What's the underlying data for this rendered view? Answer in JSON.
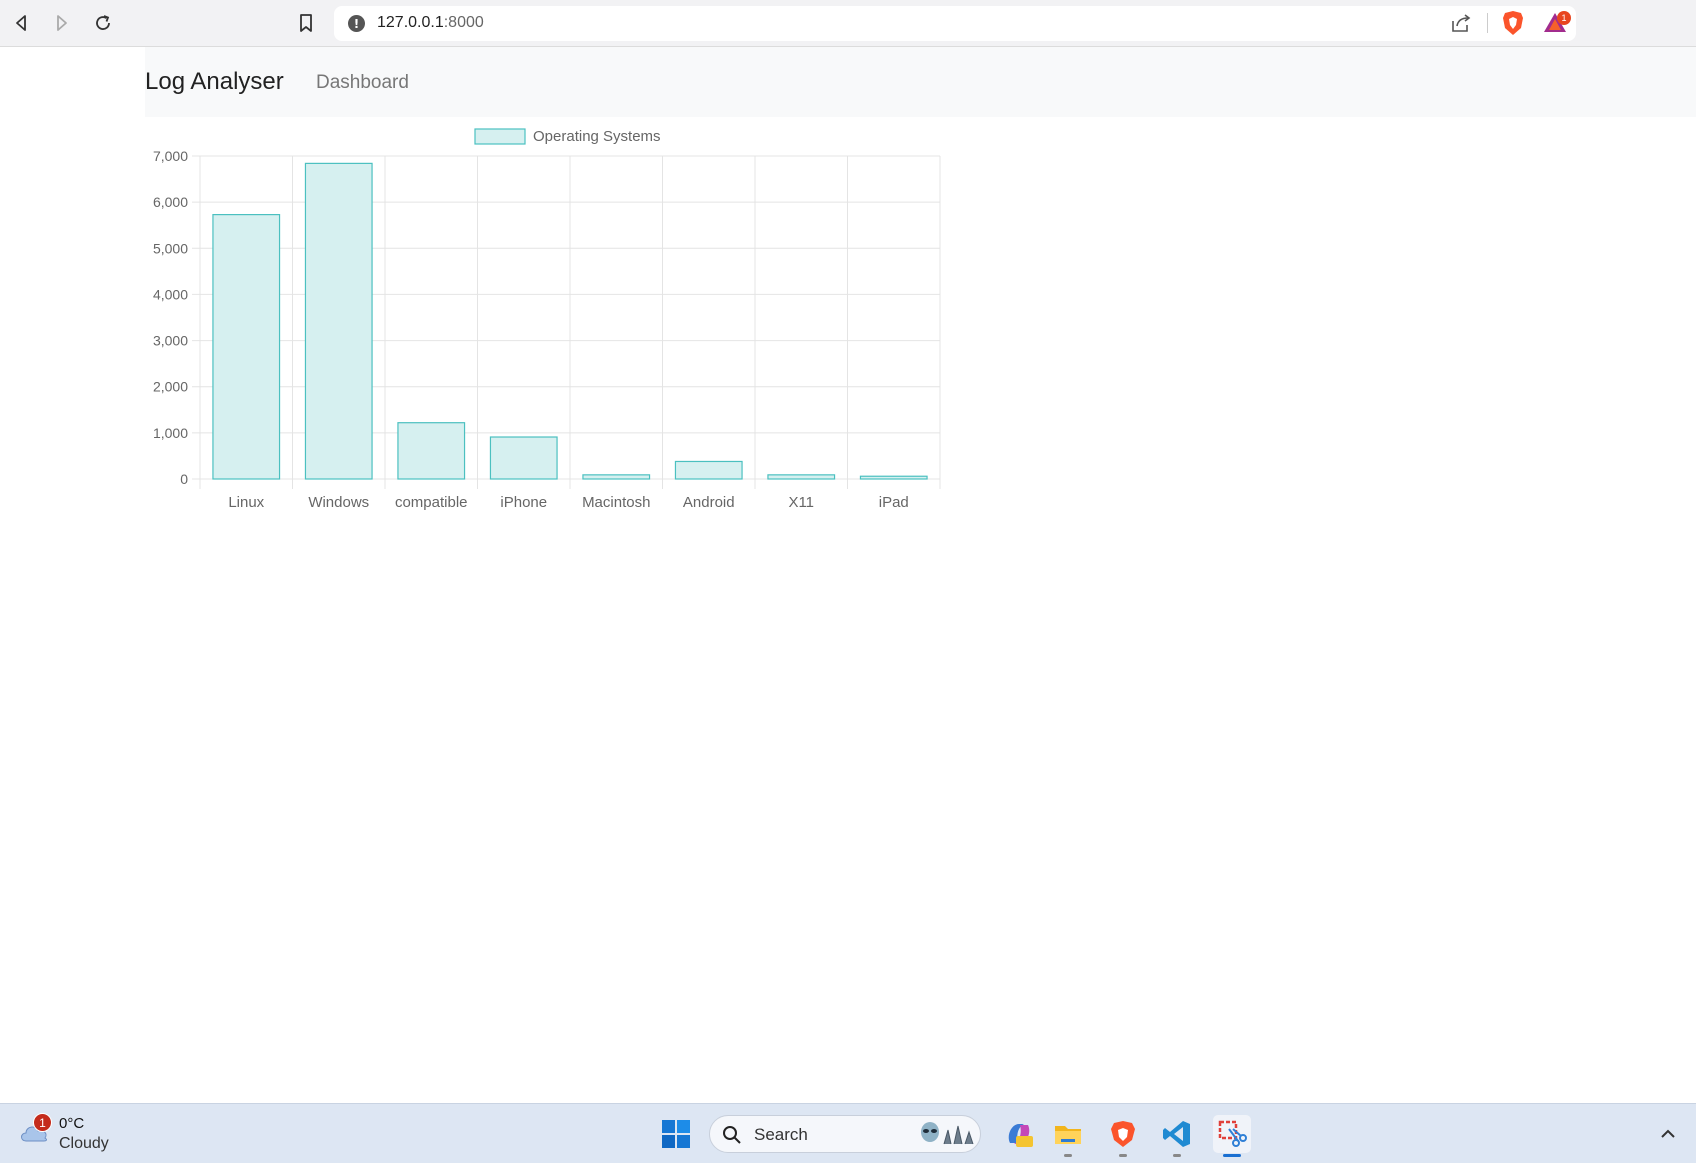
{
  "browser": {
    "url_host": "127.0.0.1",
    "url_port": ":8000",
    "rewards_count": "1"
  },
  "navbar": {
    "brand": "Log Analyser",
    "links": [
      "Dashboard"
    ]
  },
  "chart_data": {
    "type": "bar",
    "categories": [
      "Linux",
      "Windows",
      "compatible",
      "iPhone",
      "Macintosh",
      "Android",
      "X11",
      "iPad"
    ],
    "series": [
      {
        "name": "Operating Systems",
        "values": [
          5730,
          6840,
          1220,
          910,
          90,
          380,
          90,
          60
        ]
      }
    ],
    "ylim": [
      0,
      7000
    ],
    "yticks": [
      0,
      1000,
      2000,
      3000,
      4000,
      5000,
      6000,
      7000
    ],
    "ytick_labels": [
      "0",
      "1,000",
      "2,000",
      "3,000",
      "4,000",
      "5,000",
      "6,000",
      "7,000"
    ],
    "grid": true,
    "legend": "top-center",
    "fill_color": "#d6f0f0",
    "border_color": "#4bc0c0"
  },
  "taskbar": {
    "weather_badge": "1",
    "weather_temp": "0°C",
    "weather_desc": "Cloudy",
    "search_label": "Search"
  }
}
